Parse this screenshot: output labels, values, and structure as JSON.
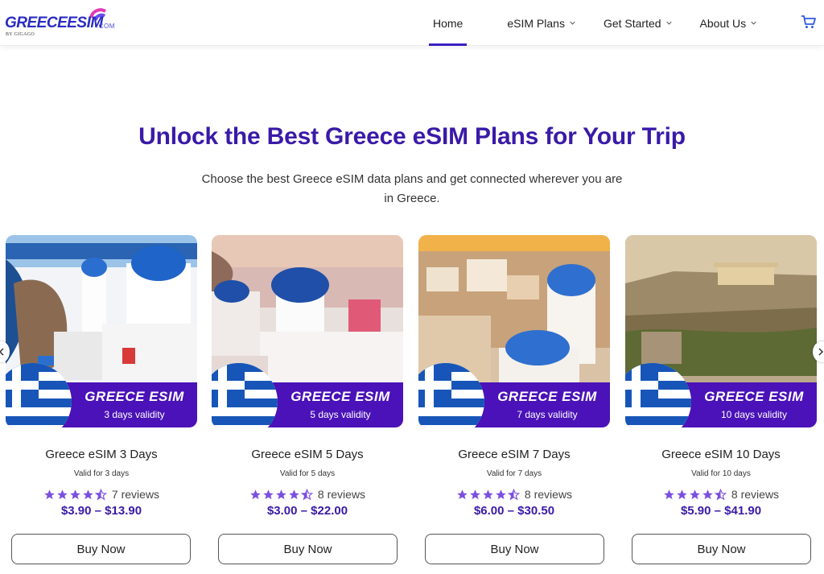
{
  "brand": {
    "logo_main": "GREECEESIM",
    "logo_com": ".COM",
    "logo_by": "BY GIGAGO"
  },
  "nav": {
    "items": [
      {
        "label": "Home",
        "active": true
      },
      {
        "label": "eSIM Plans",
        "has_dropdown": true
      },
      {
        "label": "Get Started",
        "has_dropdown": true
      },
      {
        "label": "About Us",
        "has_dropdown": true
      }
    ],
    "cart_icon": "cart-icon"
  },
  "hero": {
    "title": "Unlock the Best Greece eSIM Plans for Your Trip",
    "subtitle": "Choose the best Greece eSIM data plans and get connected wherever you are in Greece."
  },
  "cards": [
    {
      "banner_title": "GREECE ESIM",
      "banner_sub": "3 days validity",
      "name": "Greece eSIM 3 Days",
      "valid": "Valid for 3 days",
      "rating": 4.5,
      "reviews": "7 reviews",
      "price": "$3.90 – $13.90",
      "buy_label": "Buy Now"
    },
    {
      "banner_title": "GREECE ESIM",
      "banner_sub": "5 days validity",
      "name": "Greece eSIM 5 Days",
      "valid": "Valid for 5 days",
      "rating": 4.5,
      "reviews": "8 reviews",
      "price": "$3.00 – $22.00",
      "buy_label": "Buy Now"
    },
    {
      "banner_title": "GREECE ESIM",
      "banner_sub": "7 days validity",
      "name": "Greece eSIM 7 Days",
      "valid": "Valid for 7 days",
      "rating": 4.5,
      "reviews": "8 reviews",
      "price": "$6.00 – $30.50",
      "buy_label": "Buy Now"
    },
    {
      "banner_title": "GREECE ESIM",
      "banner_sub": "10 days validity",
      "name": "Greece eSIM 10 Days",
      "valid": "Valid for 10 days",
      "rating": 4.5,
      "reviews": "8 reviews",
      "price": "$5.90 – $41.90",
      "buy_label": "Buy Now"
    }
  ],
  "colors": {
    "accent": "#3a1aa8",
    "banner": "#4a12b8",
    "star": "#7b4fe0"
  }
}
